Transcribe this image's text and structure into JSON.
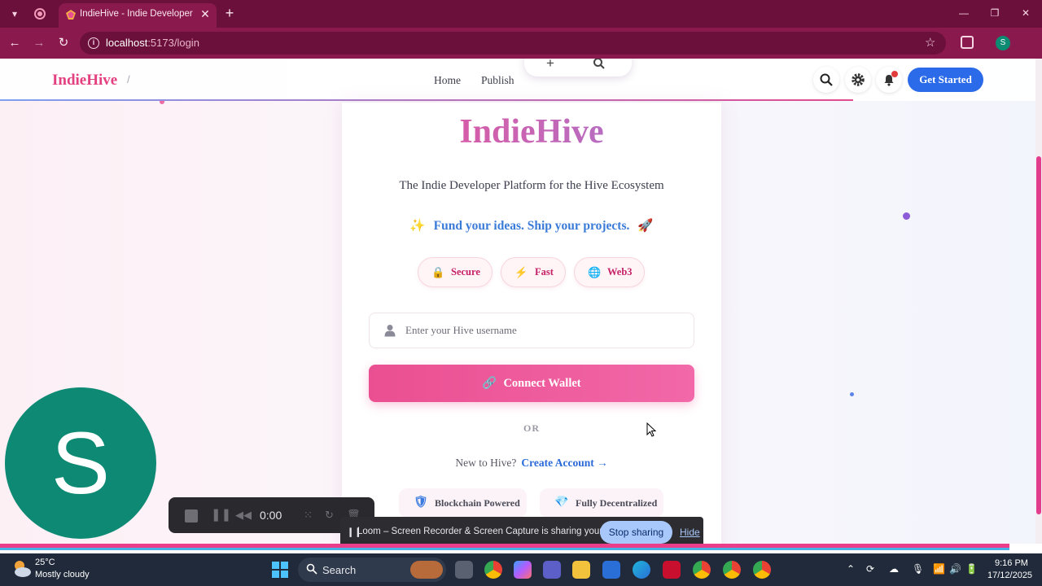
{
  "browser": {
    "tab_title": "IndieHive - Indie Developer Platform",
    "close_glyph": "✕",
    "new_tab_glyph": "+",
    "url_host": "localhost",
    "url_path": ":5173/login",
    "profile_initial": "S"
  },
  "header": {
    "brand": "IndieHive",
    "separator": "/",
    "nav": [
      "Home",
      "Publish"
    ],
    "toolbar_add": "+",
    "get_started": "Get Started"
  },
  "login": {
    "logo": "IndieHive",
    "tagline": "The Indie Developer Platform for the Hive Ecosystem",
    "motto": "Fund your ideas. Ship your projects.",
    "chips": [
      {
        "icon": "lock-icon",
        "label": "Secure"
      },
      {
        "icon": "lightning-icon",
        "label": "Fast"
      },
      {
        "icon": "globe-icon",
        "label": "Web3"
      }
    ],
    "username_placeholder": "Enter your Hive username",
    "connect_label": "Connect Wallet",
    "or_label": "OR",
    "new_to_hive": "New to Hive?",
    "create_account": "Create Account →",
    "features": [
      {
        "icon": "shield-icon",
        "label": "Blockchain Powered"
      },
      {
        "icon": "diamond-icon",
        "label": "Fully Decentralized"
      }
    ]
  },
  "overlay": {
    "avatar_initial": "S",
    "recorder_time": "0:00",
    "share_text": "Loom – Screen Recorder & Screen Capture is sharing your screen.",
    "stop_sharing": "Stop sharing",
    "hide": "Hide"
  },
  "taskbar": {
    "temperature": "25°C",
    "weather": "Mostly cloudy",
    "search_label": "Search",
    "time": "9:16 PM",
    "date": "17/12/2025"
  },
  "colors": {
    "brand_pink": "#e2407f",
    "accent_blue": "#2b6ae8",
    "chrome_maroon": "#8a1a4e"
  }
}
